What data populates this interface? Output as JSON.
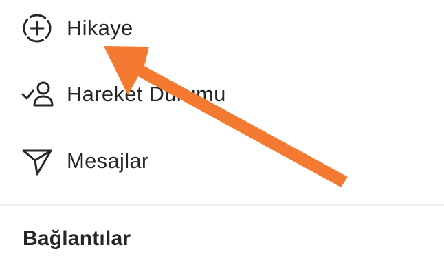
{
  "menu": {
    "items": [
      {
        "label": "Hikaye",
        "icon": "add-story-icon"
      },
      {
        "label": "Hareket Durumu",
        "icon": "activity-status-icon"
      },
      {
        "label": "Mesajlar",
        "icon": "paper-plane-icon"
      }
    ]
  },
  "section": {
    "title": "Bağlantılar"
  },
  "annotation": {
    "icon": "pointer-arrow-icon",
    "color": "#F47A31"
  },
  "colors": {
    "text": "#262626",
    "divider": "#EFEFEF",
    "background": "#FFFFFF"
  }
}
